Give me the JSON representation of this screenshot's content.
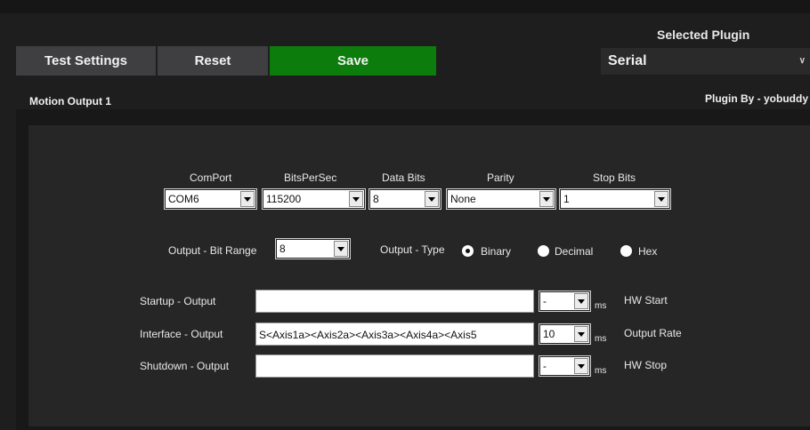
{
  "toolbar": {
    "test_settings": "Test Settings",
    "reset": "Reset",
    "save": "Save",
    "save_color": "#0c7d0c"
  },
  "plugin": {
    "label": "Selected Plugin",
    "selected": "Serial",
    "author": "Plugin By - yobuddy"
  },
  "section_title": "Motion Output 1",
  "serial": {
    "comport": {
      "label": "ComPort",
      "value": "COM6"
    },
    "baud": {
      "label": "BitsPerSec",
      "value": "115200"
    },
    "databits": {
      "label": "Data Bits",
      "value": "8"
    },
    "parity": {
      "label": "Parity",
      "value": "None"
    },
    "stopbits": {
      "label": "Stop Bits",
      "value": "1"
    }
  },
  "output": {
    "bitrange_label": "Output - Bit Range",
    "bitrange_value": "8",
    "type_label": "Output - Type",
    "types": [
      "Binary",
      "Decimal",
      "Hex"
    ],
    "selected_type": "Binary"
  },
  "rows": {
    "startup": {
      "label": "Startup - Output",
      "value": "",
      "ms_value": "-",
      "ms": "ms",
      "right": "HW Start"
    },
    "interface": {
      "label": "Interface - Output",
      "value": "S<Axis1a><Axis2a><Axis3a><Axis4a><Axis5",
      "ms_value": "10",
      "ms": "ms",
      "right": "Output Rate"
    },
    "shutdown": {
      "label": "Shutdown - Output",
      "value": "",
      "ms_value": "-",
      "ms": "ms",
      "right": "HW Stop"
    }
  }
}
